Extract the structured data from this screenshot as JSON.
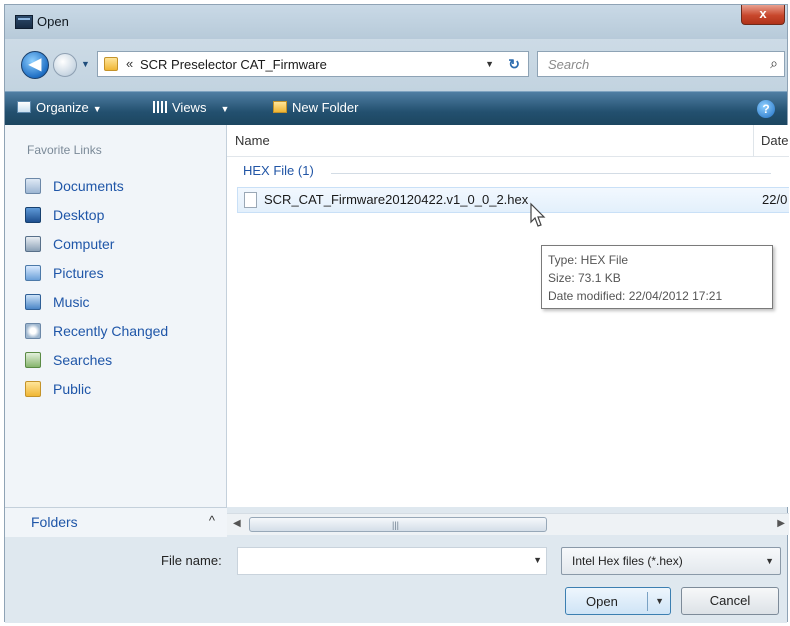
{
  "window": {
    "title": "Open",
    "close_glyph": "x"
  },
  "nav": {
    "back_glyph": "◀",
    "address_prefix": "«",
    "address_path": "SCR Preselector CAT_Firmware",
    "refresh_glyph": "↻",
    "search_placeholder": "Search",
    "search_glyph": "⌕"
  },
  "toolbar": {
    "organize_label": "Organize",
    "views_label": "Views",
    "new_folder_label": "New Folder",
    "help_glyph": "?"
  },
  "sidebar": {
    "header": "Favorite Links",
    "items": [
      {
        "label": "Documents",
        "icon": "documents-icon"
      },
      {
        "label": "Desktop",
        "icon": "desktop-icon"
      },
      {
        "label": "Computer",
        "icon": "computer-icon"
      },
      {
        "label": "Pictures",
        "icon": "pictures-icon"
      },
      {
        "label": "Music",
        "icon": "music-icon"
      },
      {
        "label": "Recently Changed",
        "icon": "recently-changed-icon"
      },
      {
        "label": "Searches",
        "icon": "searches-icon"
      },
      {
        "label": "Public",
        "icon": "public-icon"
      }
    ],
    "folders_label": "Folders",
    "folders_glyph": "^"
  },
  "filelist": {
    "columns": {
      "name": "Name",
      "date": "Date"
    },
    "group_label": "HEX File (1)",
    "files": [
      {
        "name": "SCR_CAT_Firmware20120422.v1_0_0_2.hex",
        "date": "22/0"
      }
    ],
    "tooltip": {
      "type": "Type: HEX File",
      "size": "Size: 73.1 KB",
      "modified": "Date modified: 22/04/2012 17:21"
    }
  },
  "bottom": {
    "file_name_label": "File name:",
    "file_name_value": "",
    "file_type": "Intel Hex files (*.hex)",
    "open_label": "Open",
    "cancel_label": "Cancel"
  },
  "colors": {
    "accent": "#1f56a8",
    "command_bar": "#23506f",
    "close_button": "#c8472c"
  }
}
